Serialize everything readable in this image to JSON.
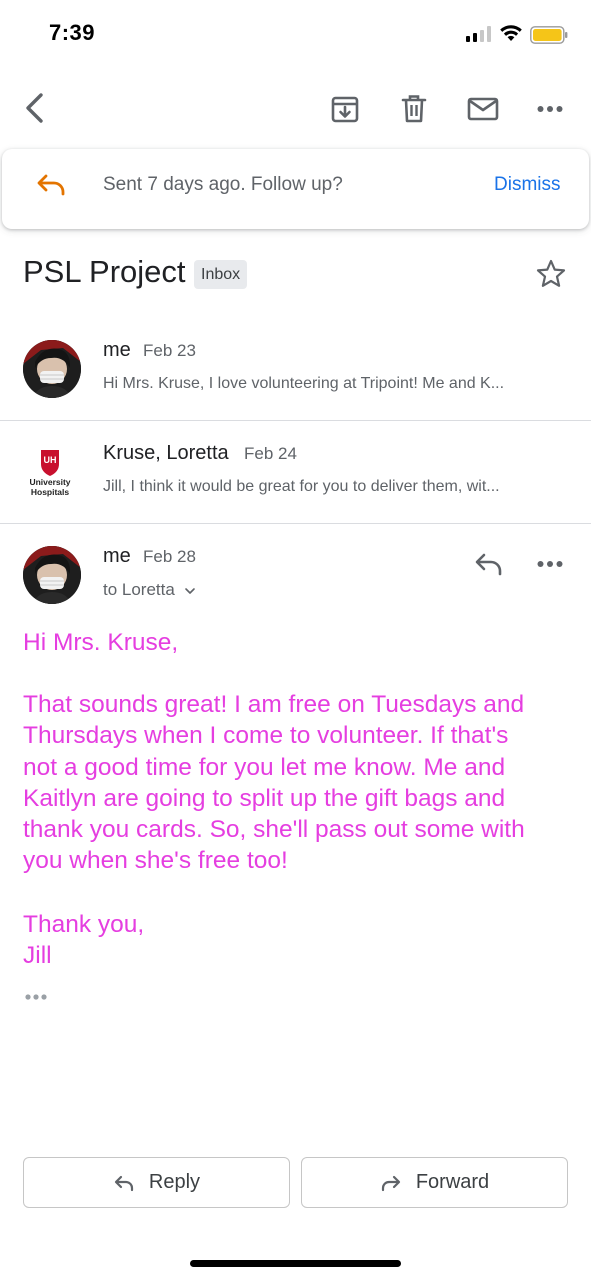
{
  "status_bar": {
    "time": "7:39"
  },
  "followup": {
    "text": "Sent 7 days ago. Follow up?",
    "dismiss_label": "Dismiss"
  },
  "thread": {
    "subject": "PSL Project",
    "label": "Inbox",
    "messages": [
      {
        "sender": "me",
        "date": "Feb 23",
        "snippet": "Hi Mrs. Kruse, I love volunteering at Tripoint! Me and K..."
      },
      {
        "sender": "Kruse, Loretta",
        "date": "Feb 24",
        "snippet": "Jill, I think it would be great for you to deliver them, wit...",
        "logo": {
          "mark": "UH",
          "name_line1": "University",
          "name_line2": "Hospitals"
        }
      },
      {
        "sender": "me",
        "date": "Feb 28",
        "to": "to Loretta"
      }
    ]
  },
  "expanded_message": {
    "greeting": "Hi Mrs. Kruse,",
    "body_lines": [
      "That sounds great! I am free on Tuesdays and",
      "Thursdays when I come to volunteer. If that's",
      "not a good time for you let me know. Me and",
      "Kaitlyn are going to split up the gift bags and",
      "thank you cards. So, she'll pass out some with",
      "you when she's free too!"
    ],
    "closing": "Thank you,",
    "signature": "Jill"
  },
  "actions": {
    "reply_label": "Reply",
    "forward_label": "Forward"
  },
  "icons": {
    "back": "back-arrow-icon",
    "archive": "archive-icon",
    "delete": "trash-icon",
    "mark_unread": "mail-icon",
    "more": "more-horizontal-icon",
    "star": "star-icon",
    "reply": "reply-icon",
    "forward": "forward-icon",
    "expand": "chevron-down-icon"
  },
  "colors": {
    "accent": "#1a73e8",
    "body_text": "#e53ee0",
    "followup_icon": "#e37400",
    "battery": "#f5c518"
  }
}
